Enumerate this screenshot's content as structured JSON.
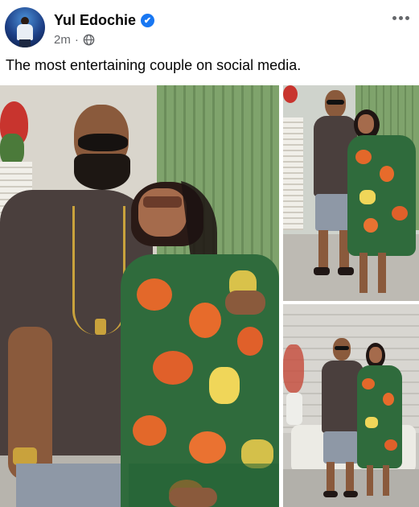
{
  "post": {
    "author": "Yul Edochie",
    "time": "2m",
    "separator": "·",
    "verified_mark": "✔",
    "text": "The most entertaining couple on social media."
  },
  "icons": {
    "verified": "verified-badge-icon",
    "audience": "globe-icon",
    "more": "more-options-icon"
  },
  "colors": {
    "verified_blue": "#1877f2",
    "meta_gray": "#65676b",
    "text": "#050505"
  }
}
